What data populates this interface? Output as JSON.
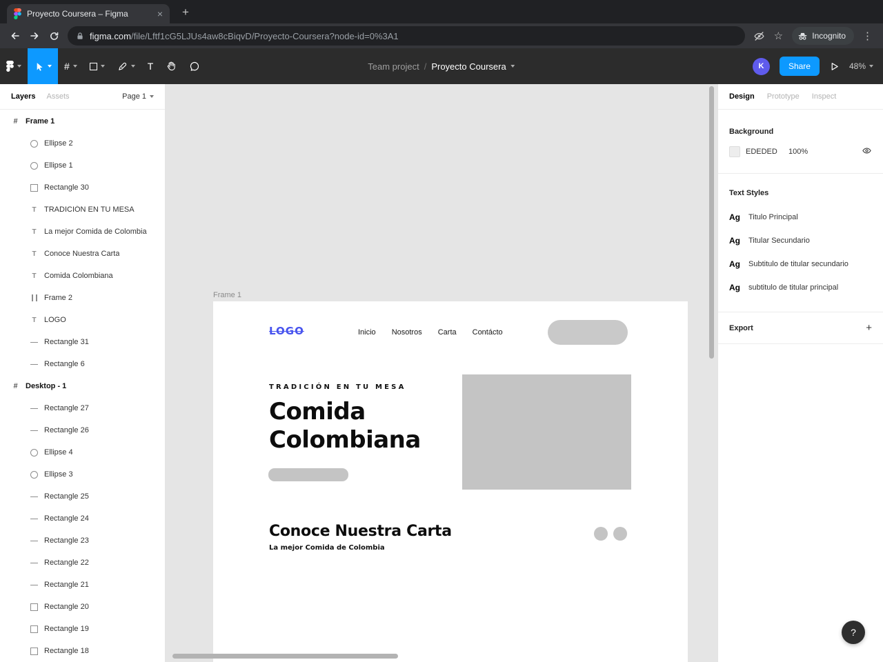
{
  "browser": {
    "tab_title": "Proyecto Coursera – Figma",
    "close_tab_icon": "×",
    "new_tab_icon": "+",
    "url": {
      "domain": "figma.com",
      "path": "/file/Lftf1cG5LJUs4aw8cBiqvD/Proyecto-Coursera?node-id=0%3A1"
    },
    "bookmark_star_icon": "☆",
    "incognito_label": "Incognito",
    "menu_dots_icon": "⋮"
  },
  "figma_toolbar": {
    "tool_glyphs": {
      "frame_tool": "#",
      "text_tool": "T"
    },
    "breadcrumb": {
      "team": "Team project",
      "separator": "/",
      "file": "Proyecto Coursera"
    },
    "avatar_initial": "K",
    "share_label": "Share",
    "zoom_level": "48%"
  },
  "left_panel": {
    "tab_layers": "Layers",
    "tab_assets": "Assets",
    "page_selector": "Page 1",
    "layers": [
      {
        "icon": "frame",
        "level": "0",
        "label": "Frame 1"
      },
      {
        "icon": "ellipse",
        "level": "1",
        "label": "Ellipse 2"
      },
      {
        "icon": "ellipse",
        "level": "1",
        "label": "Ellipse 1"
      },
      {
        "icon": "rect",
        "level": "1",
        "label": "Rectangle 30"
      },
      {
        "icon": "text",
        "level": "1",
        "label": "TRADICIÓN EN TU MESA"
      },
      {
        "icon": "text",
        "level": "1",
        "label": "La mejor Comida de Colombia"
      },
      {
        "icon": "text",
        "level": "1",
        "label": "Conoce Nuestra Carta"
      },
      {
        "icon": "text",
        "level": "1",
        "label": "Comida Colombiana"
      },
      {
        "icon": "columns",
        "level": "1",
        "label": "Frame 2"
      },
      {
        "icon": "text",
        "level": "1",
        "label": "LOGO"
      },
      {
        "icon": "line",
        "level": "1",
        "label": "Rectangle 31"
      },
      {
        "icon": "line",
        "level": "1",
        "label": "Rectangle 6"
      },
      {
        "icon": "frame",
        "level": "0",
        "label": "Desktop - 1"
      },
      {
        "icon": "line",
        "level": "1",
        "label": "Rectangle 27"
      },
      {
        "icon": "line",
        "level": "1",
        "label": "Rectangle 26"
      },
      {
        "icon": "ellipse",
        "level": "1",
        "label": "Ellipse 4"
      },
      {
        "icon": "ellipse",
        "level": "1",
        "label": "Ellipse 3"
      },
      {
        "icon": "line",
        "level": "1",
        "label": "Rectangle 25"
      },
      {
        "icon": "line",
        "level": "1",
        "label": "Rectangle 24"
      },
      {
        "icon": "line",
        "level": "1",
        "label": "Rectangle 23"
      },
      {
        "icon": "line",
        "level": "1",
        "label": "Rectangle 22"
      },
      {
        "icon": "line",
        "level": "1",
        "label": "Rectangle 21"
      },
      {
        "icon": "rect",
        "level": "1",
        "label": "Rectangle 20"
      },
      {
        "icon": "rect",
        "level": "1",
        "label": "Rectangle 19"
      },
      {
        "icon": "rect",
        "level": "1",
        "label": "Rectangle 18"
      }
    ]
  },
  "canvas": {
    "frame_label": "Frame 1",
    "design": {
      "logo": "LOGO",
      "nav_items": [
        "Inicio",
        "Nosotros",
        "Carta",
        "Contácto"
      ],
      "eyebrow": "TRADICIÓN EN TU MESA",
      "title": "Comida Colombiana",
      "section_title": "Conoce Nuestra Carta",
      "section_subtitle": "La mejor Comida de Colombia"
    }
  },
  "right_panel": {
    "tabs": {
      "design": "Design",
      "prototype": "Prototype",
      "inspect": "Inspect"
    },
    "background": {
      "heading": "Background",
      "hex": "EDEDED",
      "opacity": "100%",
      "swatch_color": "#EDEDED"
    },
    "text_styles": {
      "heading": "Text Styles",
      "items": [
        {
          "sample": "Ag",
          "name": "Titulo Principal"
        },
        {
          "sample": "Ag",
          "name": "Titular Secundario"
        },
        {
          "sample": "Ag",
          "name": "Subtitulo de titular secundario"
        },
        {
          "sample": "Ag",
          "name": "subtitulo de titular principal"
        }
      ]
    },
    "export": {
      "heading": "Export",
      "add_icon": "+"
    }
  },
  "help_button_label": "?",
  "colors": {
    "accent_blue": "#0d99ff",
    "canvas_gray": "#e5e5e5",
    "placeholder_gray": "#c4c4c4",
    "logo_blue": "#4753ee"
  }
}
